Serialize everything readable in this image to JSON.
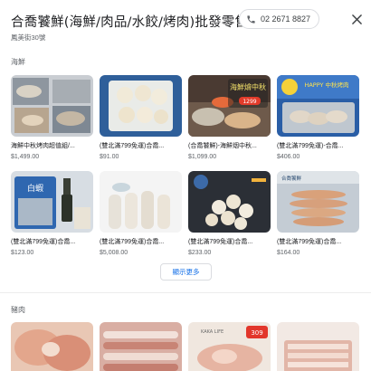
{
  "header": {
    "title": "合喬饕鮮(海鮮/肉品/水餃/烤肉)批發零售",
    "phone": "02 2671 8827",
    "subtitle": "鳳美街30號"
  },
  "sections": [
    {
      "title": "海鮮",
      "products": [
        {
          "name": "海鮮中秋烤肉超值組/...",
          "price": "$1,499.00"
        },
        {
          "name": "(雙北滿799免運)合喬...",
          "price": "$91.00"
        },
        {
          "name": "(合喬饕鮮)-海鮮烟中秋...",
          "price": "$1,099.00"
        },
        {
          "name": "(雙北滿799免運)-合喬...",
          "price": "$406.00"
        },
        {
          "name": "(雙北滿799免運)合喬...",
          "price": "$123.00"
        },
        {
          "name": "(雙北滿799免運)合喬...",
          "price": "$5,008.00"
        },
        {
          "name": "(雙北滿799免運)合喬...",
          "price": "$233.00"
        },
        {
          "name": "(雙北滿799免運)合喬...",
          "price": "$164.00"
        }
      ],
      "more_label": "顯示更多"
    },
    {
      "title": "豬肉"
    }
  ],
  "thumb_text": {
    "p3_line1": "海鮮燴中秋",
    "p3_line2": "1299",
    "p4_banner": "HAPPY 中秋烤肉",
    "p5_label": "白蝦",
    "p8_label": "合喬饕鮮",
    "m2_label": "KAKA LIFE",
    "m2_price": "309"
  },
  "colors": {
    "accent": "#1a73e8",
    "text_primary": "#202124",
    "text_secondary": "#5f6368",
    "border": "#dadce0"
  }
}
